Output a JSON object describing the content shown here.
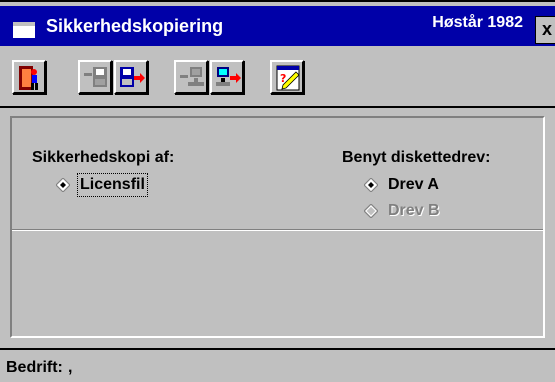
{
  "window": {
    "title": "Sikkerhedskopiering",
    "title_right": "Høstår 1982",
    "close_label": "x"
  },
  "toolbar": {
    "buttons": [
      {
        "icon": "exit-door-icon"
      },
      {
        "icon": "disk-backup-icon"
      },
      {
        "icon": "disk-restore-icon"
      },
      {
        "icon": "network-backup-icon"
      },
      {
        "icon": "network-transfer-icon"
      },
      {
        "icon": "help-pencil-icon"
      }
    ]
  },
  "backup_source": {
    "label": "Sikkerhedskopi af:",
    "options": [
      {
        "label": "Licensfil",
        "selected": true,
        "enabled": true
      }
    ]
  },
  "drive": {
    "label": "Benyt diskettedrev:",
    "options": [
      {
        "label": "Drev A",
        "selected": true,
        "enabled": true
      },
      {
        "label": "Drev B",
        "selected": false,
        "enabled": false
      }
    ]
  },
  "status": {
    "label": "Bedrift:",
    "value": ","
  },
  "colors": {
    "titlebar": "#0000a8",
    "face": "#c0c0c0"
  }
}
